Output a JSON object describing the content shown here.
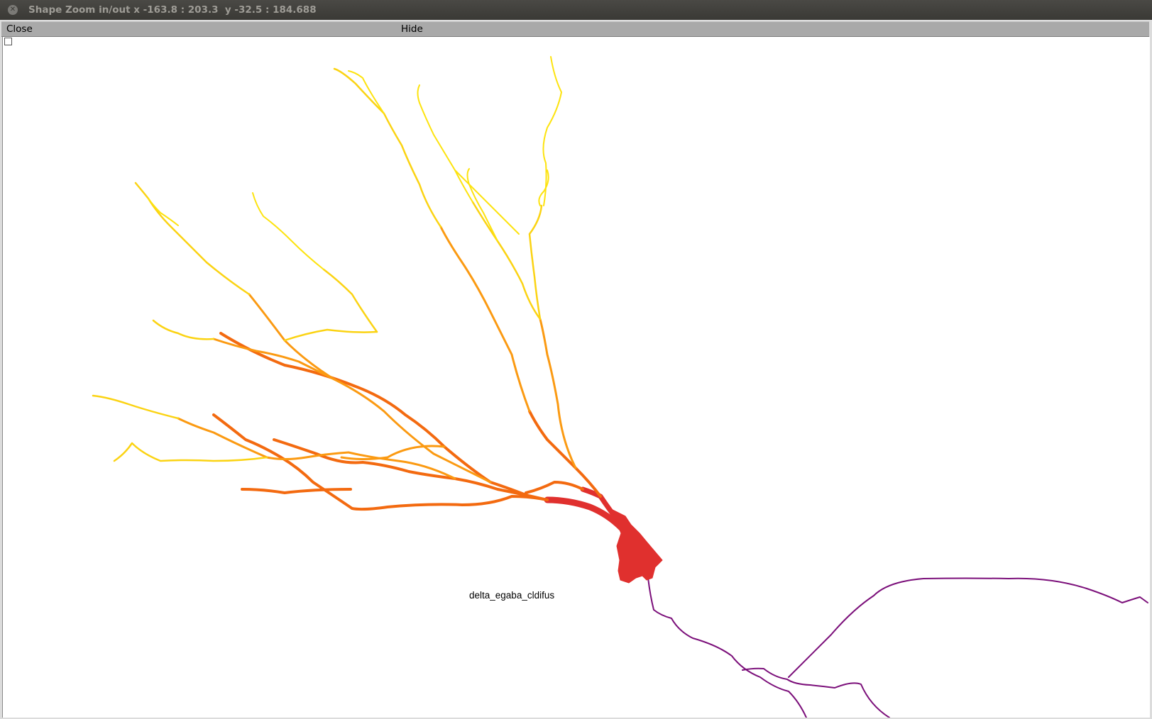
{
  "window": {
    "title": "Shape Zoom in/out x -163.8 : 203.3  y -32.5 : 184.688",
    "close_icon": "close-icon"
  },
  "toolbar": {
    "close_label": "Close",
    "hide_label": "Hide"
  },
  "canvas": {
    "shape_label": "delta_egaba_cldifus",
    "checkbox_checked": false
  },
  "colors": {
    "soma": "#e0302e",
    "proximal_dendrite": "#f36a10",
    "mid_dendrite": "#fb9a12",
    "distal_dendrite": "#fbd313",
    "tip_dendrite": "#fde30f",
    "axon": "#7b0f7a"
  }
}
